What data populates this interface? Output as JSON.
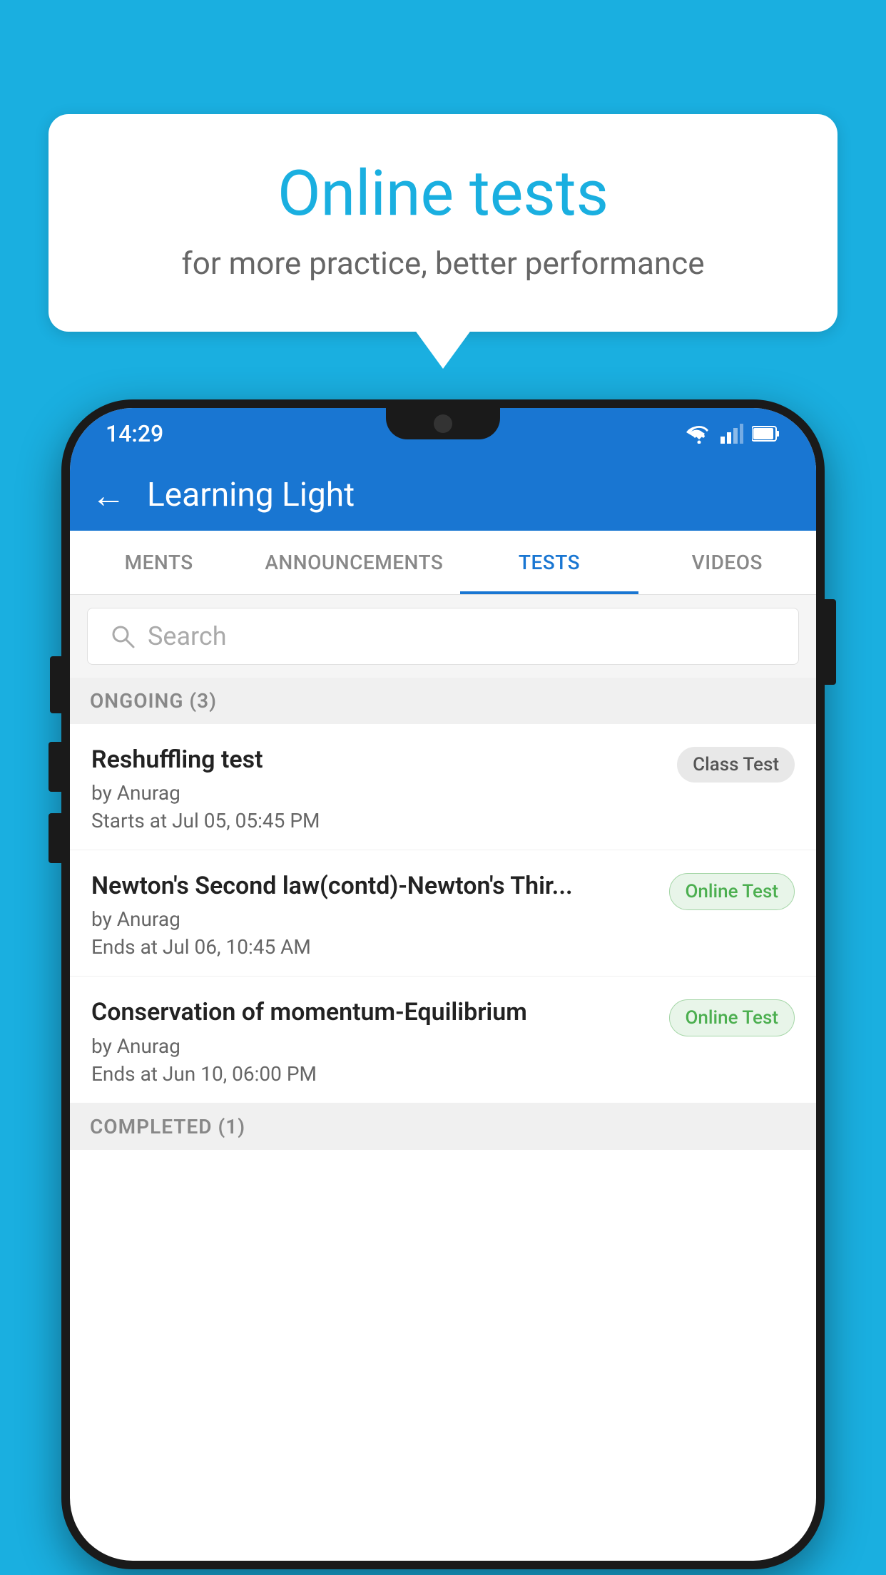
{
  "background_color": "#1AAFE0",
  "speech_bubble": {
    "title": "Online tests",
    "subtitle": "for more practice, better performance"
  },
  "phone": {
    "status_bar": {
      "time": "14:29",
      "wifi": "▾",
      "signal": "▴▴",
      "battery": "▮"
    },
    "app_bar": {
      "back_label": "←",
      "title": "Learning Light"
    },
    "tabs": [
      {
        "label": "MENTS",
        "active": false
      },
      {
        "label": "ANNOUNCEMENTS",
        "active": false
      },
      {
        "label": "TESTS",
        "active": true
      },
      {
        "label": "VIDEOS",
        "active": false
      }
    ],
    "search": {
      "placeholder": "Search"
    },
    "ongoing_section": {
      "title": "ONGOING (3)"
    },
    "tests": [
      {
        "name": "Reshuffling test",
        "by": "by Anurag",
        "time_label": "Starts at",
        "time_value": "Jul 05, 05:45 PM",
        "badge_text": "Class Test",
        "badge_type": "class"
      },
      {
        "name": "Newton's Second law(contd)-Newton's Thir...",
        "by": "by Anurag",
        "time_label": "Ends at",
        "time_value": "Jul 06, 10:45 AM",
        "badge_text": "Online Test",
        "badge_type": "online"
      },
      {
        "name": "Conservation of momentum-Equilibrium",
        "by": "by Anurag",
        "time_label": "Ends at",
        "time_value": "Jun 10, 06:00 PM",
        "badge_text": "Online Test",
        "badge_type": "online"
      }
    ],
    "completed_section": {
      "title": "COMPLETED (1)"
    }
  }
}
